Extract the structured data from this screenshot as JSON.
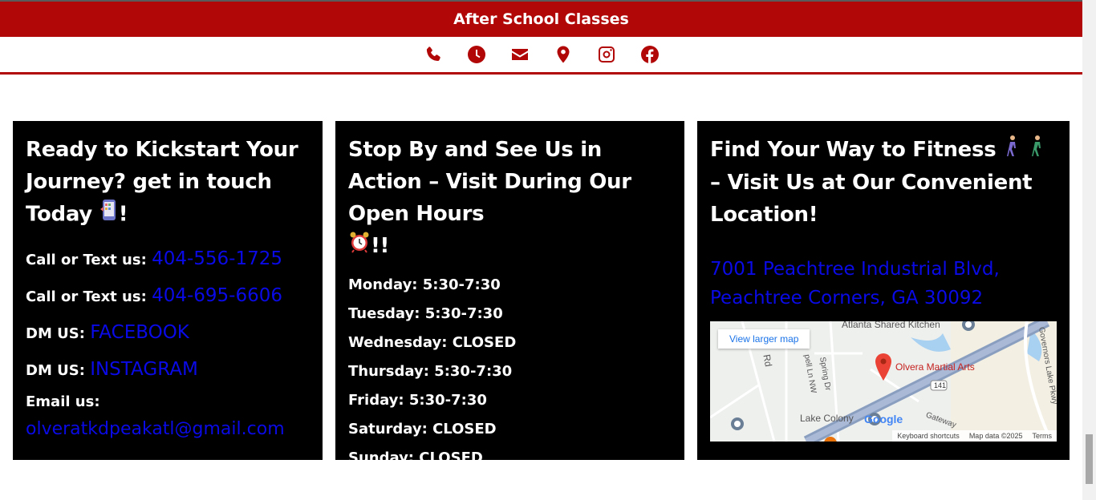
{
  "banner": {
    "title": "After School Classes",
    "color": "#b10707"
  },
  "icons": [
    "phone-icon",
    "clock-icon",
    "envelope-icon",
    "map-pin-icon",
    "instagram-icon",
    "facebook-icon"
  ],
  "contact": {
    "heading": "Ready to Kickstart Your Journey? get in touch Today",
    "heading_suffix": "!",
    "rows": [
      {
        "label": "Call or Text us:",
        "value": "404-556-1725"
      },
      {
        "label": "Call or Text us:",
        "value": "404-695-6606"
      },
      {
        "label": "DM US:",
        "value": "FACEBOOK"
      },
      {
        "label": "DM US:",
        "value": "INSTAGRAM"
      }
    ],
    "email_label": "Email us:",
    "email": "olveratkdpeakatl@gmail.com"
  },
  "hours": {
    "heading": "Stop By and See Us in Action – Visit During Our Open Hours",
    "heading_suffix": "!!",
    "days": [
      "Monday: 5:30-7:30",
      "Tuesday: 5:30-7:30",
      "Wednesday: CLOSED",
      "Thursday: 5:30-7:30",
      "Friday: 5:30-7:30",
      "Saturday: CLOSED",
      "Sunday: CLOSED"
    ]
  },
  "location": {
    "heading_part1": "Find Your Way to Fitness",
    "heading_part2": "– Visit Us at Our Convenient Location!",
    "address_line1": "7001 Peachtree Industrial Blvd,",
    "address_line2": "Peachtree Corners, GA 30092",
    "map": {
      "view_larger": "View larger map",
      "poi_top": "Atlanta Shared Kitchen",
      "poi_main": "Olvera Martial Arts",
      "road_rd": "Rd",
      "road_pell": "pell Ln NW",
      "road_spring": "Spring Dr",
      "road_gov": "Governors Lake Pkwy",
      "route": "141",
      "area": "Lake Colony",
      "road_gateway": "Gateway",
      "google": "Google",
      "shortcuts": "Keyboard shortcuts",
      "mapdata": "Map data ©2025",
      "terms": "Terms"
    }
  }
}
